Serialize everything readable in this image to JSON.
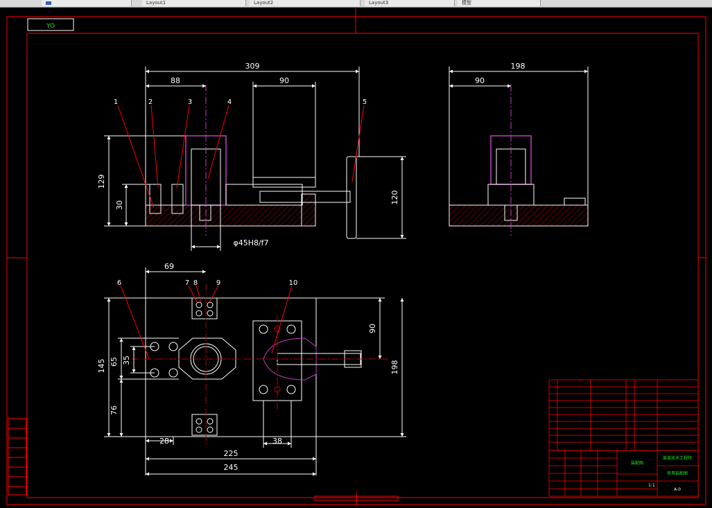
{
  "tabs": [
    {
      "label": ""
    },
    {
      "label": "Layout1"
    },
    {
      "label": "Layout2"
    },
    {
      "label": "Layout3"
    },
    {
      "label": "模型"
    }
  ],
  "drawing": {
    "stamp": "YO",
    "dims_front": {
      "d309": "309",
      "d88": "88",
      "d90": "90",
      "d129": "129",
      "d30": "30",
      "d120": "120",
      "fit": "φ45H8/f7"
    },
    "dims_side": {
      "d198": "198",
      "d90": "90"
    },
    "dims_plan": {
      "d69": "69",
      "d145": "145",
      "d65": "65",
      "d35": "35",
      "d76": "76",
      "d90": "90",
      "d198": "198",
      "d28": "28",
      "d38": "38",
      "d225": "225",
      "d245": "245"
    },
    "balloons": [
      "1",
      "2",
      "3",
      "4",
      "5",
      "6",
      "7",
      "8",
      "9",
      "10"
    ]
  },
  "title_block": {
    "drawing_name": "装配图",
    "company": "某某技术工程院",
    "part_name": "夹具装配图",
    "scale": "1:1",
    "code": "A-0"
  },
  "colors": {
    "background": "#000000",
    "frame": "#ff0000",
    "geometry": "#ffffff",
    "hatch": "#c00000",
    "purple": "#c040c0",
    "dimension": "#ffffff",
    "text_green": "#20e020"
  }
}
